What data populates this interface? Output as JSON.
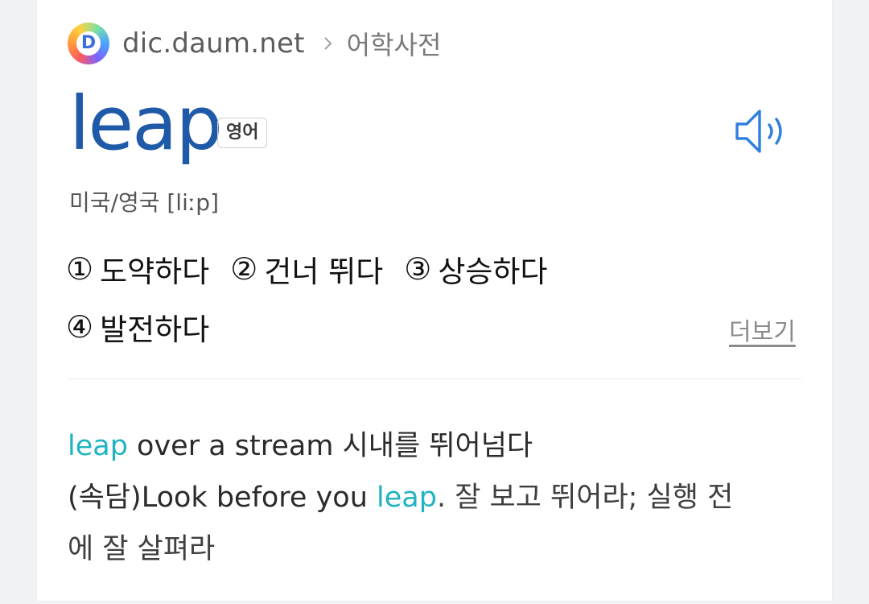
{
  "header": {
    "site": "dic.daum.net",
    "breadcrumb": "어학사전",
    "logo_letter": "D"
  },
  "entry": {
    "word": "leap",
    "language_badge": "영어",
    "pronunciation": "미국/영국 [liːp]",
    "speaker_icon": "speaker-icon",
    "more_label": "더보기",
    "meanings": [
      {
        "num": "①",
        "text": "도약하다"
      },
      {
        "num": "②",
        "text": "건너 뛰다"
      },
      {
        "num": "③",
        "text": "상승하다"
      },
      {
        "num": "④",
        "text": "발전하다"
      }
    ]
  },
  "examples": [
    {
      "highlight": "leap",
      "rest": " over a stream  시내를 뛰어넘다"
    },
    {
      "prefix": "(속담)Look before you ",
      "highlight": "leap",
      "suffix": ".  잘 보고 뛰어라; 실행 전",
      "continuation": "에 잘 살펴라"
    }
  ],
  "colors": {
    "word": "#1f5aa8",
    "highlight": "#20b3c1",
    "speaker": "#2f7fe0"
  }
}
